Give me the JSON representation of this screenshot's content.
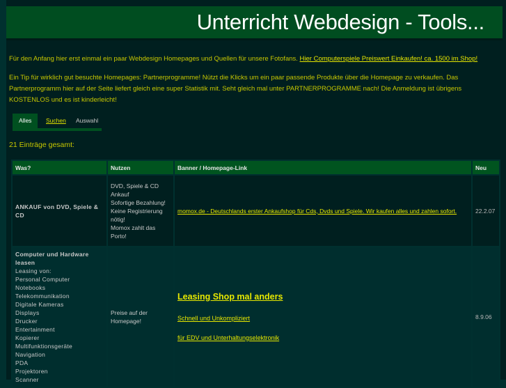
{
  "header": {
    "title": "Unterricht Webdesign - Tools..."
  },
  "intro": {
    "line1_text": "Für den Anfang hier erst einmal ein paar Webdesign Homepages und Quellen für unsere Fotofans. ",
    "line1_link": "Hier Computerspiele Preiswert Einkaufen! ca. 1500 im Shop!",
    "paragraph2": "Ein Tip für wirklich gut besuchte Homepages: Partnerprogramme! Nützt die Klicks um ein paar passende Produkte über die Homepage zu verkaufen. Das Partnerprogramm hier auf der Seite liefert gleich eine super Statistik mit. Seht gleich mal unter PARTNERPROGRAMME nach! Die Anmeldung ist übrigens KOSTENLOS und es ist kinderleicht!"
  },
  "tabs": [
    {
      "label": "Alles",
      "active": true
    },
    {
      "label": "Suchen",
      "active": false
    },
    {
      "label": "Auswahl",
      "active": false
    }
  ],
  "count_label": "21 Einträge gesamt:",
  "table": {
    "headers": [
      "Was?",
      "Nutzen",
      "Banner / Homepage-Link",
      "Neu"
    ],
    "rows": [
      {
        "what": "ANKAUF von DVD, Spiele & CD",
        "use_lines": [
          "DVD, Spiele & CD Ankauf",
          "Sofortige Bezahlung!",
          "Keine Registrierung nötig!",
          "Momox zahlt das Porto!"
        ],
        "link": "momox.de - Deutschlands erster Ankaufshop für Cds, Dvds und Spiele. Wir kaufen alles und zahlen sofort.",
        "date": "22.2.07"
      },
      {
        "what_title": "Computer und Hardware leasen",
        "what_lines": [
          "Leasing von:",
          "Personal Computer",
          "Notebooks",
          "Telekommunikation",
          "Digitale Kameras",
          "Displays",
          "Drucker",
          "Entertainment",
          "Kopierer",
          "Multifunktionsgeräte",
          "Navigation",
          "PDA",
          "Projektoren",
          "Scanner"
        ],
        "use": "Preise auf der Homepage!",
        "links": [
          "Leasing Shop mal anders ",
          "Schnell und Unkompliziert ",
          "für EDV und Unterhaltungselektronik "
        ],
        "date": "8.9.06"
      }
    ]
  }
}
